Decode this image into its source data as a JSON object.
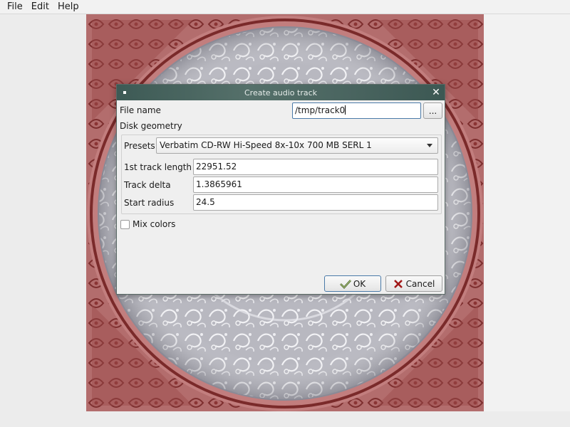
{
  "menubar": {
    "items": [
      "File",
      "Edit",
      "Help"
    ]
  },
  "colors": {
    "artwork_red": "#b06a6a",
    "disc_gray": "#b9b9c2",
    "titlebar": "#4a6560"
  },
  "dialog": {
    "title": "Create audio track",
    "file_name_label": "File name",
    "file_name_value": "/tmp/track0",
    "browse_label": "...",
    "disk_geometry_label": "Disk geometry",
    "presets_label": "Presets",
    "presets_value": "Verbatim CD-RW Hi-Speed 8x-10x 700 MB SERL 1",
    "first_track_length_label": "1st track length",
    "first_track_length_value": "22951.52",
    "track_delta_label": "Track delta",
    "track_delta_value": "1.3865961",
    "start_radius_label": "Start radius",
    "start_radius_value": "24.5",
    "mix_colors_label": "Mix colors",
    "mix_colors_checked": false,
    "ok_label": "OK",
    "cancel_label": "Cancel"
  }
}
